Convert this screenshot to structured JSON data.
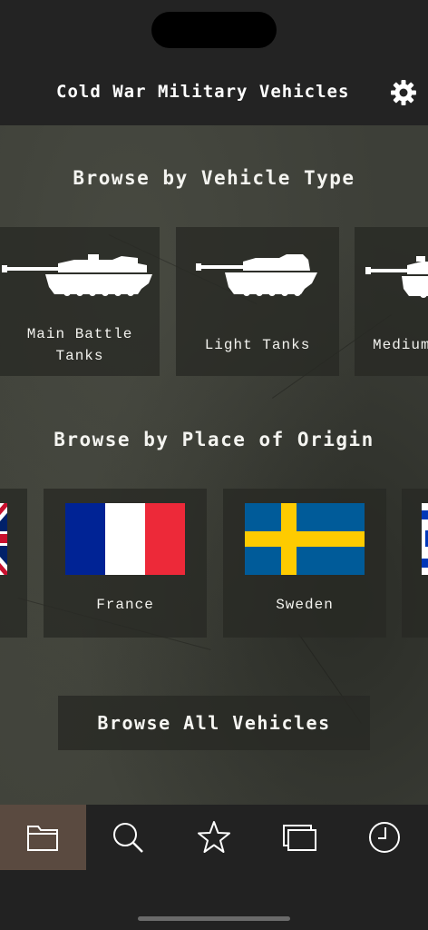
{
  "header": {
    "title": "Cold War Military Vehicles",
    "settings_icon": "gear-icon"
  },
  "vehicle_types": {
    "title": "Browse by Vehicle Type",
    "items": [
      {
        "label_line1": "Main Battle",
        "label_line2": "Tanks",
        "icon": "main-battle-tank-silhouette-icon"
      },
      {
        "label": "Light Tanks",
        "icon": "light-tank-silhouette-icon"
      },
      {
        "label": "Medium",
        "icon": "medium-tank-silhouette-icon"
      }
    ]
  },
  "origins": {
    "title": "Browse by Place of Origin",
    "items": [
      {
        "label": "",
        "icon": "united-kingdom-flag-icon"
      },
      {
        "label": "France",
        "icon": "france-flag-icon"
      },
      {
        "label": "Sweden",
        "icon": "sweden-flag-icon"
      },
      {
        "label": "",
        "icon": "israel-flag-icon"
      }
    ]
  },
  "browse_all": {
    "label": "Browse All Vehicles"
  },
  "tabbar": {
    "items": [
      {
        "icon": "folder-icon",
        "active": true
      },
      {
        "icon": "search-icon",
        "active": false
      },
      {
        "icon": "star-icon",
        "active": false
      },
      {
        "icon": "windows-icon",
        "active": false
      },
      {
        "icon": "clock-icon",
        "active": false
      }
    ]
  },
  "colors": {
    "active_tab": "#5a4a40",
    "background": "#222222",
    "card": "#2a2b25"
  }
}
